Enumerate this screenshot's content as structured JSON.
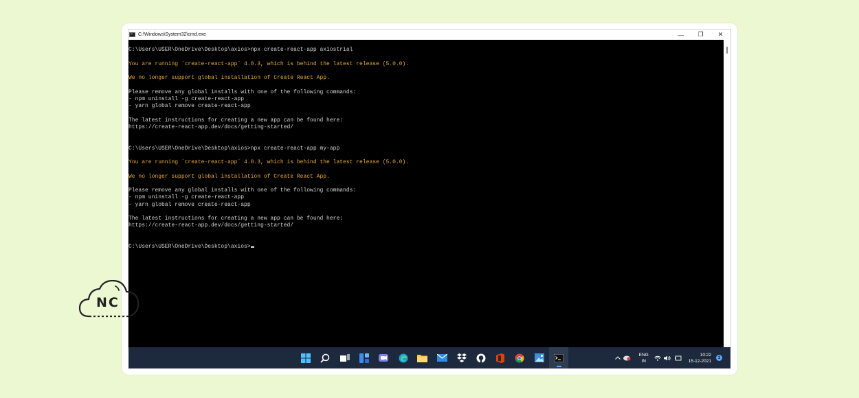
{
  "window": {
    "title": "C:\\Windows\\System32\\cmd.exe",
    "controls": {
      "minimize": "—",
      "maximize": "❐",
      "close": "✕"
    }
  },
  "console": {
    "lines": [
      {
        "text": "C:\\Users\\USER\\OneDrive\\Desktop\\axios>npx create-react-app axiostrial",
        "kind": "normal"
      },
      {
        "text": "",
        "kind": "normal"
      },
      {
        "text": "You are running `create-react-app` 4.0.3, which is behind the latest release (5.0.0).",
        "kind": "warn"
      },
      {
        "text": "",
        "kind": "normal"
      },
      {
        "text": "We no longer support global installation of Create React App.",
        "kind": "warn"
      },
      {
        "text": "",
        "kind": "normal"
      },
      {
        "text": "Please remove any global installs with one of the following commands:",
        "kind": "normal"
      },
      {
        "text": "- npm uninstall -g create-react-app",
        "kind": "normal"
      },
      {
        "text": "- yarn global remove create-react-app",
        "kind": "normal"
      },
      {
        "text": "",
        "kind": "normal"
      },
      {
        "text": "The latest instructions for creating a new app can be found here:",
        "kind": "normal"
      },
      {
        "text": "https://create-react-app.dev/docs/getting-started/",
        "kind": "normal"
      },
      {
        "text": "",
        "kind": "normal"
      },
      {
        "text": "",
        "kind": "normal"
      },
      {
        "text": "C:\\Users\\USER\\OneDrive\\Desktop\\axios>npx create-react-app my-app",
        "kind": "normal"
      },
      {
        "text": "",
        "kind": "normal"
      },
      {
        "text": "You are running `create-react-app` 4.0.3, which is behind the latest release (5.0.0).",
        "kind": "warn"
      },
      {
        "text": "",
        "kind": "normal"
      },
      {
        "text": "We no longer support global installation of Create React App.",
        "kind": "warn"
      },
      {
        "text": "",
        "kind": "normal"
      },
      {
        "text": "Please remove any global installs with one of the following commands:",
        "kind": "normal"
      },
      {
        "text": "- npm uninstall -g create-react-app",
        "kind": "normal"
      },
      {
        "text": "- yarn global remove create-react-app",
        "kind": "normal"
      },
      {
        "text": "",
        "kind": "normal"
      },
      {
        "text": "The latest instructions for creating a new app can be found here:",
        "kind": "normal"
      },
      {
        "text": "https://create-react-app.dev/docs/getting-started/",
        "kind": "normal"
      },
      {
        "text": "",
        "kind": "normal"
      },
      {
        "text": "",
        "kind": "normal"
      }
    ],
    "prompt": "C:\\Users\\USER\\OneDrive\\Desktop\\axios>",
    "colors": {
      "text": "#d4d4d4",
      "warn": "#e5a93a",
      "background": "#000000"
    }
  },
  "taskbar": {
    "background": "#1d2a3d",
    "apps": [
      {
        "name": "start-icon"
      },
      {
        "name": "search-icon"
      },
      {
        "name": "task-view-icon"
      },
      {
        "name": "widgets-icon"
      },
      {
        "name": "teams-chat-icon"
      },
      {
        "name": "edge-icon"
      },
      {
        "name": "file-explorer-icon"
      },
      {
        "name": "mail-icon"
      },
      {
        "name": "dropbox-icon"
      },
      {
        "name": "github-icon"
      },
      {
        "name": "office-icon"
      },
      {
        "name": "chrome-icon"
      },
      {
        "name": "photos-icon"
      },
      {
        "name": "terminal-icon"
      }
    ],
    "tray": {
      "lang_top": "ENG",
      "lang_bottom": "IN",
      "time": "10:22",
      "date": "15-12-2021",
      "notifications": "3"
    }
  },
  "logo": {
    "text": "NC"
  }
}
